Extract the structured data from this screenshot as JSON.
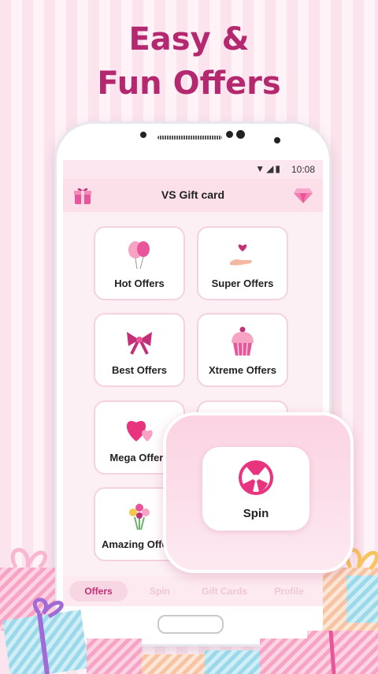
{
  "headline": {
    "line1": "Easy &",
    "line2": "Fun Offers"
  },
  "status_bar": {
    "time": "10:08"
  },
  "app": {
    "title": "VS Gift card"
  },
  "cards": [
    {
      "label": "Hot Offers",
      "icon": "balloons-icon"
    },
    {
      "label": "Super Offers",
      "icon": "heart-hand-icon"
    },
    {
      "label": "Best Offers",
      "icon": "bow-icon"
    },
    {
      "label": "Xtreme Offers",
      "icon": "cupcake-icon"
    },
    {
      "label": "Mega Offers",
      "icon": "hearts-icon"
    },
    {
      "label": "Amazing Offers",
      "icon": "flowers-icon"
    }
  ],
  "spin_popup": {
    "label": "Spin",
    "icon": "spin-wheel-icon"
  },
  "tabs": [
    {
      "label": "Offers",
      "active": true
    },
    {
      "label": "Spin",
      "active": false
    },
    {
      "label": "Gift Cards",
      "active": false
    },
    {
      "label": "Profile",
      "active": false
    }
  ],
  "colors": {
    "accent": "#b4286f",
    "pink": "#e8559b",
    "light_pink": "#fbdfe9"
  }
}
